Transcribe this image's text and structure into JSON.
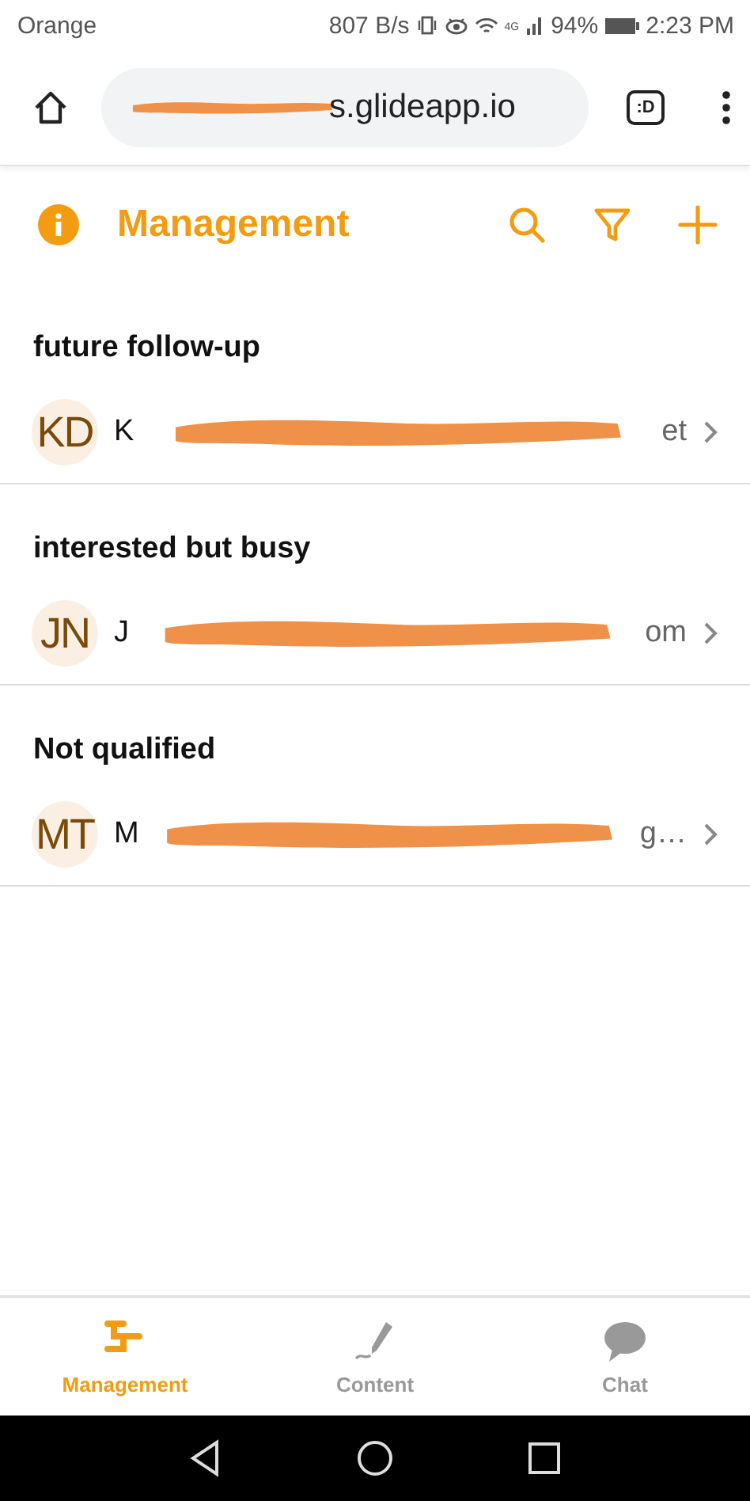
{
  "status_bar": {
    "carrier": "Orange",
    "speed": "807 B/s",
    "network": "4G",
    "battery": "94%",
    "time": "2:23 PM"
  },
  "browser": {
    "url_visible": "s.glideapp.io",
    "tab_badge": ":D"
  },
  "header": {
    "title": "Management"
  },
  "groups": [
    {
      "heading": "future follow-up",
      "rows": [
        {
          "initials": "KD",
          "text_start": "K",
          "text_end": "et"
        }
      ]
    },
    {
      "heading": "interested but busy",
      "rows": [
        {
          "initials": "JN",
          "text_start": "J",
          "text_end": "om"
        }
      ]
    },
    {
      "heading": "Not qualified",
      "rows": [
        {
          "initials": "MT",
          "text_start": "M",
          "text_end": "g…"
        }
      ]
    }
  ],
  "tabs": [
    {
      "label": "Management",
      "kind": "tree",
      "selected": true
    },
    {
      "label": "Content",
      "kind": "pen",
      "selected": false
    },
    {
      "label": "Chat",
      "kind": "chat",
      "selected": false
    }
  ]
}
